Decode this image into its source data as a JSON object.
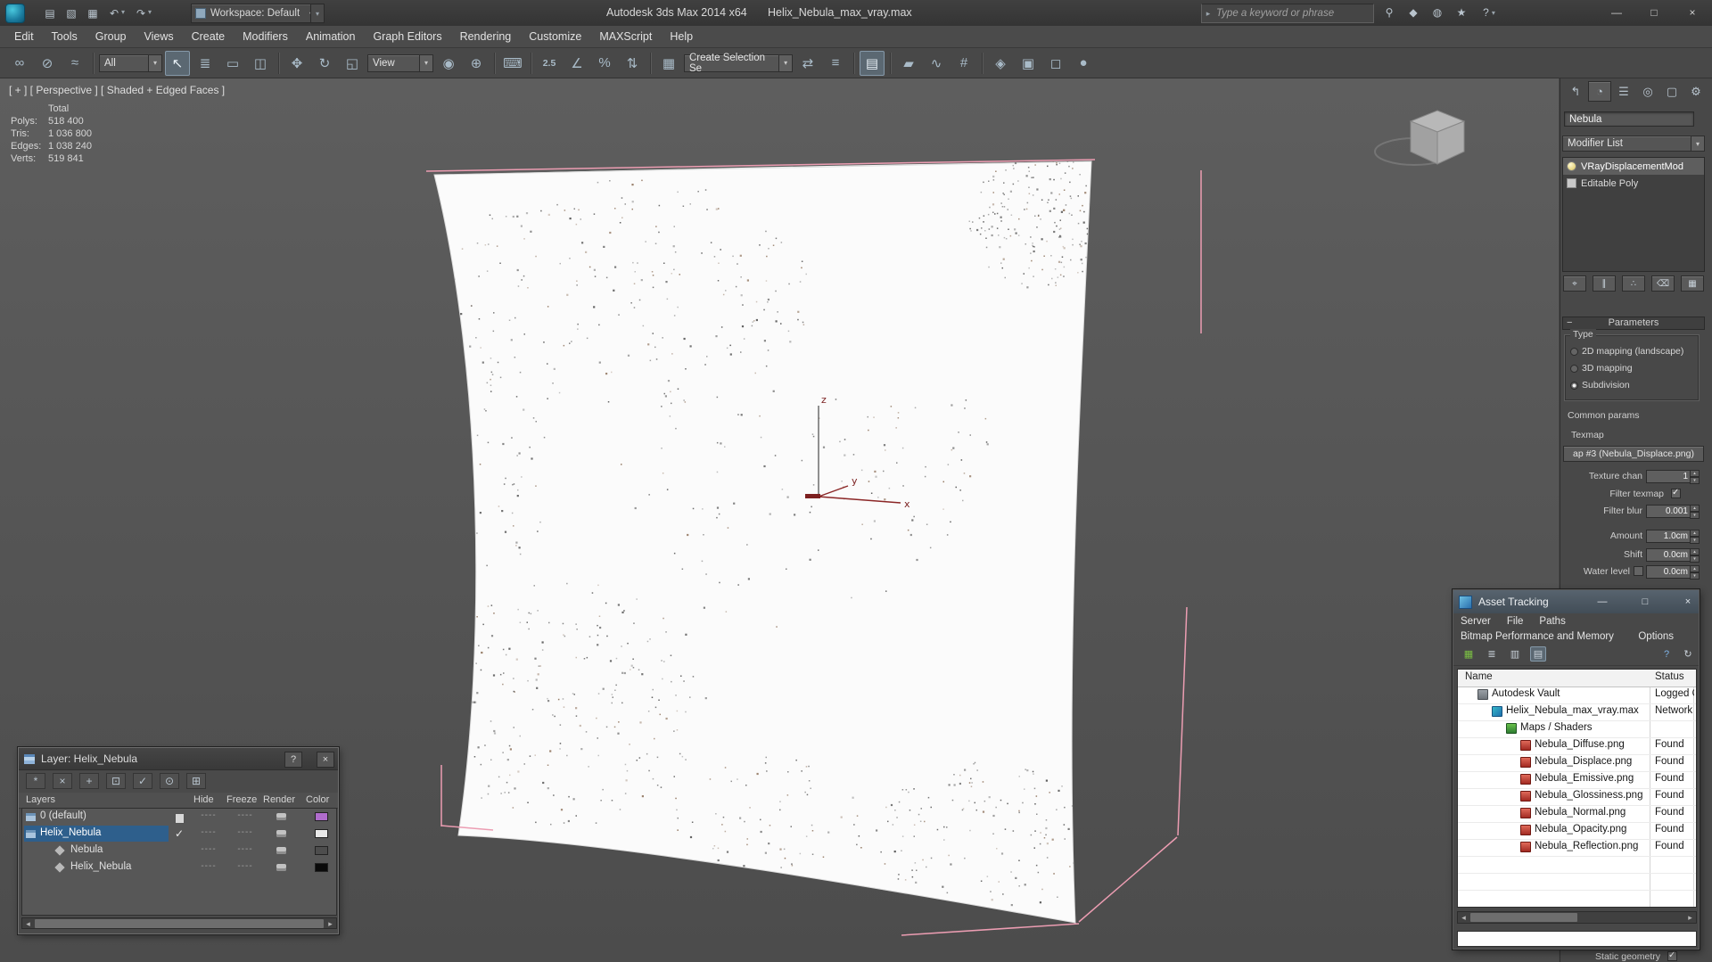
{
  "colors": {
    "accent-blue": "#2e5f8c",
    "selection-pink": "#ec9db2"
  },
  "titlebar": {
    "workspace_label": "Workspace: Default",
    "app_title": "Autodesk 3ds Max 2014 x64",
    "file_title": "Helix_Nebula_max_vray.max",
    "search_placeholder": "Type a keyword or phrase"
  },
  "menubar": {
    "items": [
      "Edit",
      "Tools",
      "Group",
      "Views",
      "Create",
      "Modifiers",
      "Animation",
      "Graph Editors",
      "Rendering",
      "Customize",
      "MAXScript",
      "Help"
    ]
  },
  "toolbar": {
    "selection_filter": "All",
    "ref_coord": "View",
    "named_sets": "Create Selection Se",
    "snap_label": "2.5"
  },
  "viewport": {
    "label": "[ + ] [ Perspective ] [ Shaded + Edged Faces ]",
    "stats_header": "Total",
    "stats": [
      {
        "label": "Polys:",
        "value": "518 400"
      },
      {
        "label": "Tris:",
        "value": "1 036 800"
      },
      {
        "label": "Edges:",
        "value": "1 038 240"
      },
      {
        "label": "Verts:",
        "value": "519 841"
      }
    ],
    "axis": {
      "x": "x",
      "y": "y",
      "z": "z"
    }
  },
  "command_panel": {
    "object_name": "Nebula",
    "modifier_list": "Modifier List",
    "stack": [
      "VRayDisplacementMod",
      "Editable Poly"
    ],
    "rollout": "Parameters",
    "type_label": "Type",
    "type_options": [
      "2D mapping (landscape)",
      "3D mapping",
      "Subdivision"
    ],
    "common_params": "Common params",
    "texmap_label": "Texmap",
    "texmap_button": "ap #3 (Nebula_Displace.png)",
    "texture_chan_label": "Texture chan",
    "texture_chan_value": "1",
    "filter_texmap_label": "Filter texmap",
    "filter_blur_label": "Filter blur",
    "filter_blur_value": "0.001",
    "amount_label": "Amount",
    "amount_value": "1.0cm",
    "shift_label": "Shift",
    "shift_value": "0.0cm",
    "water_level_label": "Water level",
    "water_level_value": "0.0cm",
    "static_geometry_label": "Static geometry"
  },
  "asset_tracking": {
    "title": "Asset Tracking",
    "menus": [
      "Server",
      "File",
      "Paths"
    ],
    "menus2": [
      "Bitmap Performance and Memory",
      "Options"
    ],
    "columns": [
      "Name",
      "Status"
    ],
    "rows": [
      {
        "name": "Autodesk Vault",
        "status": "Logged Ou"
      },
      {
        "name": "Helix_Nebula_max_vray.max",
        "status": "Network P"
      },
      {
        "name": "Maps / Shaders",
        "status": ""
      },
      {
        "name": "Nebula_Diffuse.png",
        "status": "Found"
      },
      {
        "name": "Nebula_Displace.png",
        "status": "Found"
      },
      {
        "name": "Nebula_Emissive.png",
        "status": "Found"
      },
      {
        "name": "Nebula_Glossiness.png",
        "status": "Found"
      },
      {
        "name": "Nebula_Normal.png",
        "status": "Found"
      },
      {
        "name": "Nebula_Opacity.png",
        "status": "Found"
      },
      {
        "name": "Nebula_Reflection.png",
        "status": "Found"
      }
    ]
  },
  "layer_window": {
    "title": "Layer: Helix_Nebula",
    "columns": [
      "Layers",
      "Hide",
      "Freeze",
      "Render",
      "Color"
    ],
    "dash": "----",
    "rows": [
      {
        "name": "0 (default)",
        "color": "#b06ccc"
      },
      {
        "name": "Helix_Nebula",
        "color": "#e8e8e8"
      },
      {
        "name": "Nebula",
        "color": "#4d4d4d"
      },
      {
        "name": "Helix_Nebula",
        "color": "#0a0a0a"
      }
    ]
  },
  "icons": {
    "arrow_down": "▾",
    "qat_new": "▤",
    "qat_open": "▧",
    "qat_save": "▦",
    "qat_undo": "↶",
    "qat_redo": "↷",
    "search_go": "▸",
    "magnifier": "⚲",
    "subscription": "◆",
    "comm_center": "◍",
    "favorites": "★",
    "help": "?",
    "win_min": "—",
    "win_max": "□",
    "win_close": "×",
    "link": "∞",
    "unlink": "⊘",
    "bind_warp": "≈",
    "select": "↖",
    "select_by_name": "≣",
    "rect_region": "▭",
    "window_crossing": "◫",
    "move": "✥",
    "rotate": "↻",
    "scale": "◱",
    "pivot": "◉",
    "manipulate": "⊕",
    "kbd": "⌨",
    "angle": "∠",
    "percent": "%",
    "spin_snap": "⇅",
    "named_sets": "▦",
    "mirror": "⇄",
    "align": "≡",
    "layers": "▤",
    "ribbon": "▰",
    "curve": "∿",
    "schematic": "#",
    "material": "◈",
    "render_setup": "▣",
    "rfw": "◻",
    "render": "●",
    "tab_create": "↰",
    "tab_modify": "◔",
    "tab_hierarchy": "☰",
    "tab_motion": "◎",
    "tab_display": "▢",
    "tab_utilities": "⚙",
    "pin": "⌖",
    "show_end": "∥",
    "unique": "∴",
    "remove_mod": "⌫",
    "configure": "▦",
    "at_report": "▦",
    "at_list": "≣",
    "at_thumb": "▥",
    "at_table": "▤",
    "at_help": "?",
    "at_refresh": "↻",
    "lw_new": "*",
    "lw_delete": "×",
    "lw_add": "+",
    "lw_select": "⊡",
    "lw_current": "✓",
    "lw_pick": "⊙",
    "lw_highlight": "⊞",
    "arrow_left": "◂",
    "arrow_right": "▸",
    "check": "✓",
    "minus": "−",
    "spin_up": "▴",
    "spin_down": "▾"
  }
}
